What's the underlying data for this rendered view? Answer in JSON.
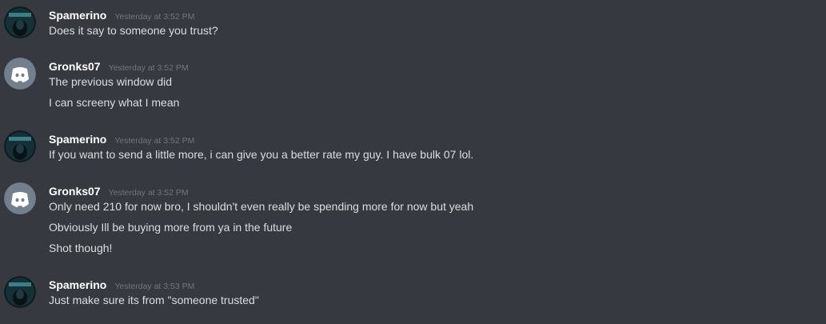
{
  "messages": [
    {
      "username": "Spamerino",
      "timestamp": "Yesterday at 3:52 PM",
      "avatar_icon": "hacker-avatar-icon",
      "lines": [
        "Does it say to someone you trust?"
      ]
    },
    {
      "username": "Gronks07",
      "timestamp": "Yesterday at 3:52 PM",
      "avatar_icon": "discord-default-avatar-icon",
      "lines": [
        "The previous window did",
        "I can screeny what I mean"
      ]
    },
    {
      "username": "Spamerino",
      "timestamp": "Yesterday at 3:52 PM",
      "avatar_icon": "hacker-avatar-icon",
      "lines": [
        "If you want to send a little more, i can give you a better rate my guy. I have bulk 07 lol."
      ]
    },
    {
      "username": "Gronks07",
      "timestamp": "Yesterday at 3:52 PM",
      "avatar_icon": "discord-default-avatar-icon",
      "lines": [
        "Only need 210 for now bro, I shouldn't even really be spending more for now but yeah",
        "Obviously Ill be buying more from ya in the future",
        "Shot though!"
      ]
    },
    {
      "username": "Spamerino",
      "timestamp": "Yesterday at 3:53 PM",
      "avatar_icon": "hacker-avatar-icon",
      "lines": [
        "Just make sure its from \"someone trusted\""
      ]
    }
  ],
  "colors": {
    "background": "#36393f",
    "username": "#ffffff",
    "timestamp": "#72767d",
    "message_text": "#dcddde",
    "default_avatar": "#747f8d"
  }
}
